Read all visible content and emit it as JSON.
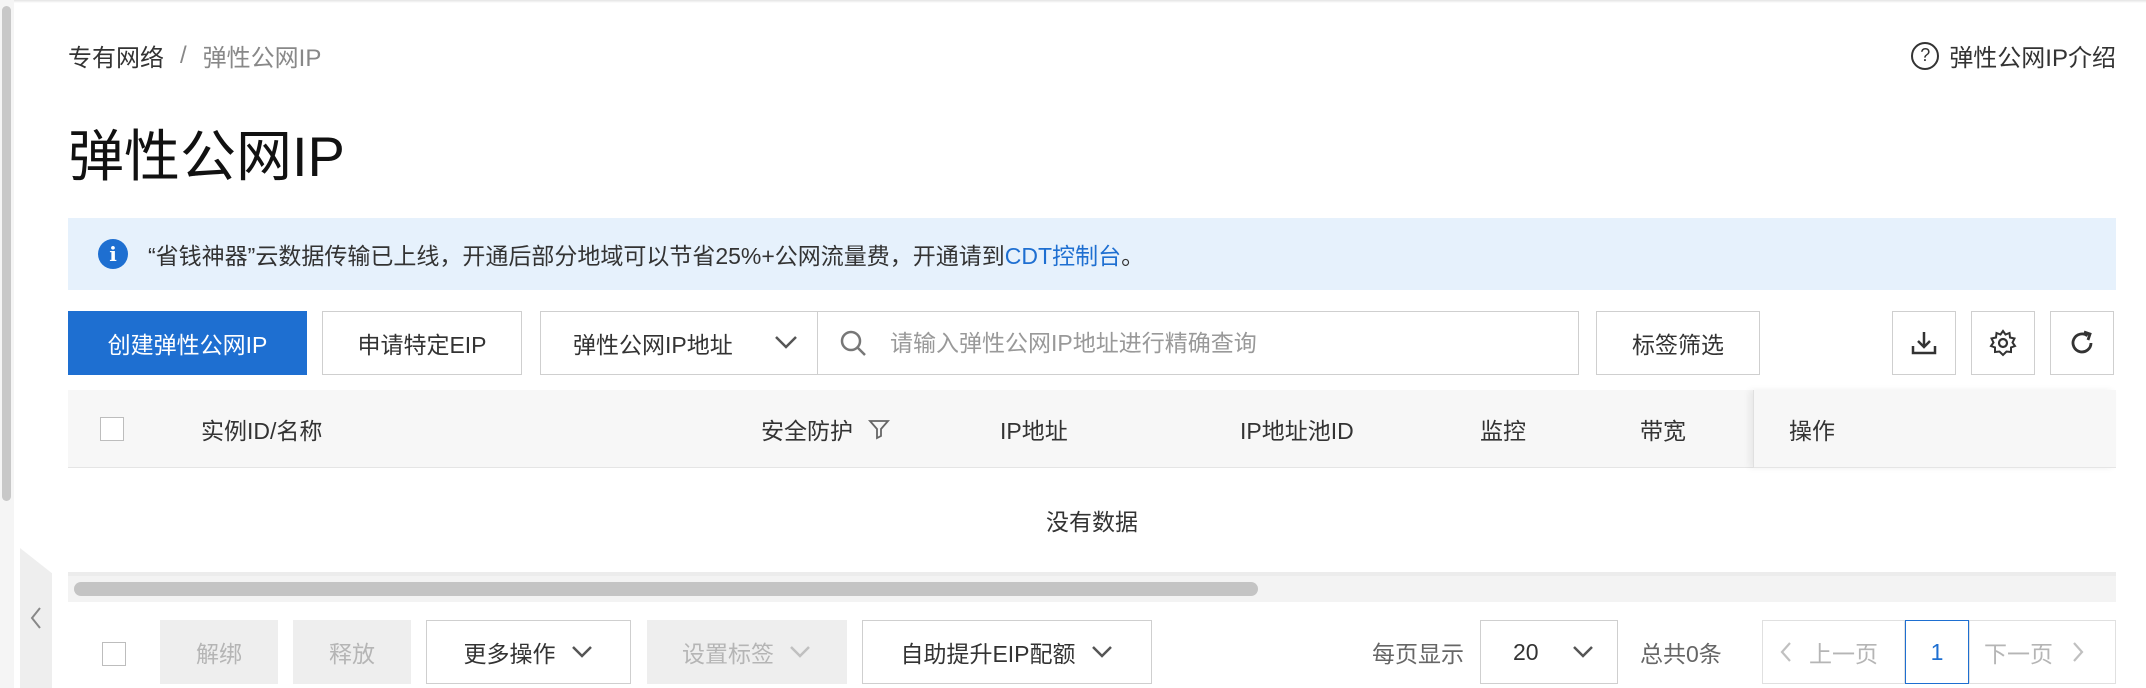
{
  "breadcrumb": {
    "root": "专有网络",
    "separator": "/",
    "current": "弹性公网IP"
  },
  "help_link": "弹性公网IP介绍",
  "page_title": "弹性公网IP",
  "notice": {
    "text": "“省钱神器”云数据传输已上线，开通后部分地域可以节省25%+公网流量费，开通请到",
    "link": "CDT控制台",
    "suffix": "。"
  },
  "toolbar": {
    "create_label": "创建弹性公网IP",
    "apply_label": "申请特定EIP",
    "filter_select": "弹性公网IP地址",
    "search_placeholder": "请输入弹性公网IP地址进行精确查询",
    "tag_filter_label": "标签筛选",
    "icons": [
      "download-icon",
      "settings-icon",
      "refresh-icon"
    ]
  },
  "table": {
    "columns": [
      "实例ID/名称",
      "安全防护",
      "IP地址",
      "IP地址池ID",
      "监控",
      "带宽",
      "操作"
    ],
    "empty_text": "没有数据"
  },
  "footer": {
    "unbind_label": "解绑",
    "release_label": "释放",
    "more_label": "更多操作",
    "set_tag_label": "设置标签",
    "quota_label": "自助提升EIP配额",
    "per_page_label": "每页显示",
    "page_size": "20",
    "total_label": "总共0条",
    "prev_label": "上一页",
    "current_page": "1",
    "next_label": "下一页"
  },
  "colors": {
    "primary": "#1e6fd1",
    "notice_bg": "#e6f1fc",
    "header_bg": "#f7f7f7"
  }
}
